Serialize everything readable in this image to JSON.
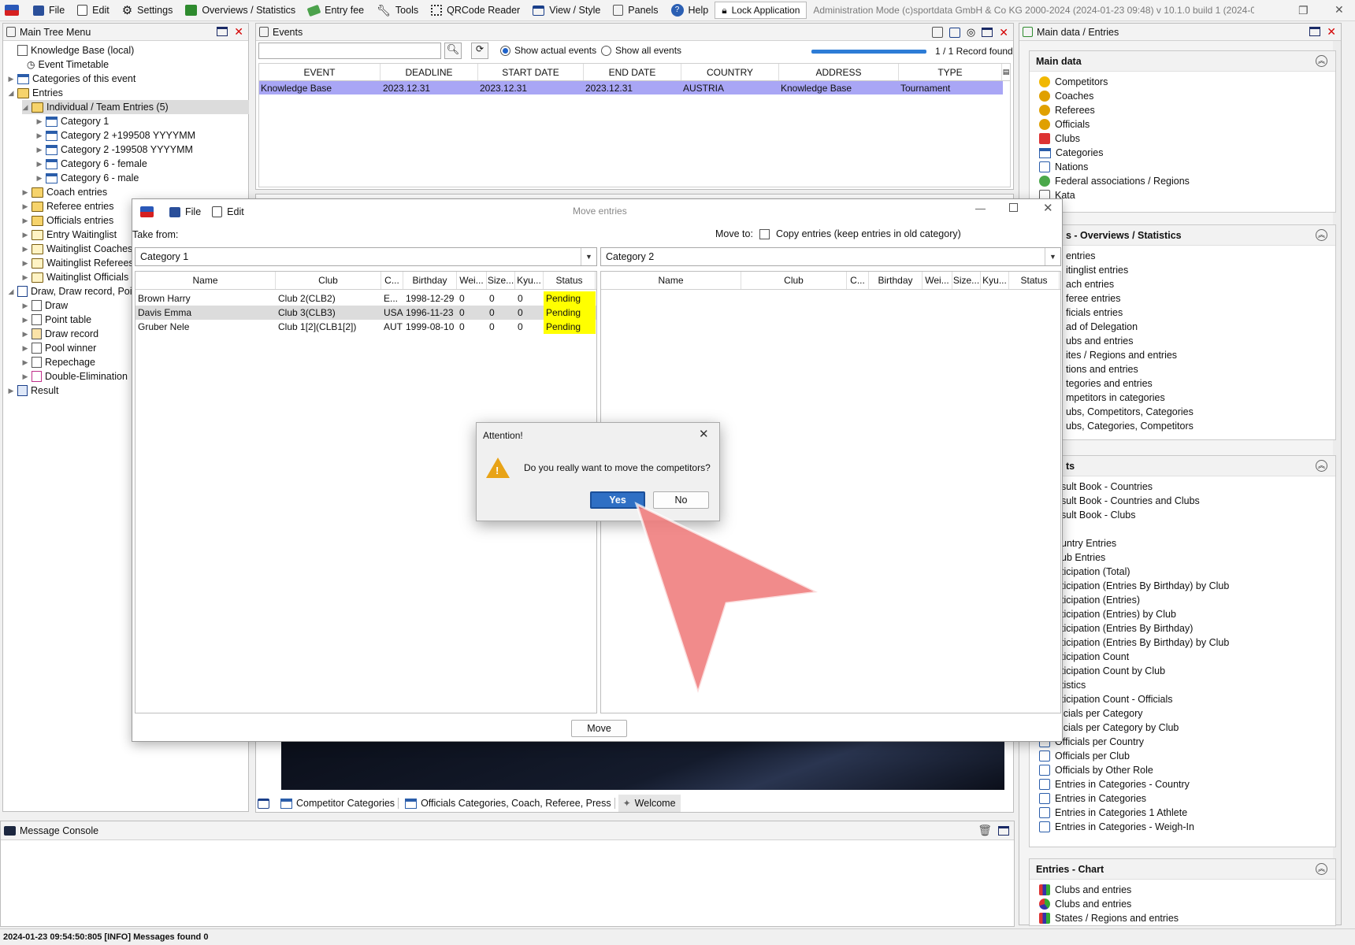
{
  "menu": {
    "items": [
      "File",
      "Edit",
      "Settings",
      "Overviews / Statistics",
      "Entry fee",
      "Tools",
      "QRCode Reader",
      "View / Style",
      "Panels",
      "Help"
    ],
    "lock_label": "Lock Application",
    "admin_text": "Administration Mode (c)sportdata GmbH & Co KG 2000-2024 (2024-01-23 09:48)  v 10.1.0 build 1 (2024-01..."
  },
  "tree_panel": {
    "title": "Main Tree Menu",
    "nodes": [
      {
        "label": "Knowledge Base (local)"
      },
      {
        "label": "Event Timetable"
      },
      {
        "label": "Categories of this event"
      },
      {
        "label": "Entries"
      },
      {
        "label": "Individual / Team Entries (5)"
      },
      {
        "label": "Category 1"
      },
      {
        "label": "Category 2 +199508 YYYYMM"
      },
      {
        "label": "Category 2 -199508 YYYYMM"
      },
      {
        "label": "Category 6 - female"
      },
      {
        "label": "Category 6 - male"
      },
      {
        "label": "Coach entries"
      },
      {
        "label": "Referee entries"
      },
      {
        "label": "Officials entries"
      },
      {
        "label": "Entry Waitinglist"
      },
      {
        "label": "Waitinglist Coaches"
      },
      {
        "label": "Waitinglist Referees"
      },
      {
        "label": "Waitinglist Officials"
      },
      {
        "label": "Draw, Draw record, Poi"
      },
      {
        "label": "Draw"
      },
      {
        "label": "Point table"
      },
      {
        "label": "Draw record"
      },
      {
        "label": "Pool winner"
      },
      {
        "label": "Repechage"
      },
      {
        "label": "Double-Elimination"
      },
      {
        "label": "Result"
      }
    ]
  },
  "events_panel": {
    "title": "Events",
    "radio_actual": "Show actual events",
    "radio_all": "Show all events",
    "record_found": "1 / 1 Record found",
    "columns": [
      "EVENT",
      "DEADLINE",
      "START DATE",
      "END DATE",
      "COUNTRY",
      "ADDRESS",
      "TYPE"
    ],
    "rows": [
      [
        "Knowledge Base",
        "2023.12.31",
        "2023.12.31",
        "2023.12.31",
        "AUSTRIA",
        "Knowledge Base",
        "Tournament"
      ]
    ]
  },
  "move_dialog": {
    "title": "Move entries",
    "menu_file": "File",
    "menu_edit": "Edit",
    "take_from_label": "Take from:",
    "move_to_label": "Move to:",
    "copy_label": "Copy entries (keep entries in old category)",
    "from_category": "Category 1",
    "to_category": "Category 2",
    "columns": [
      "Name",
      "Club",
      "C...",
      "Birthday",
      "Wei...",
      "Size...",
      "Kyu...",
      "Status"
    ],
    "rows": [
      [
        "Brown Harry",
        "Club 2(CLB2)",
        "E...",
        "1998-12-29",
        "0",
        "0",
        "0",
        "Pending"
      ],
      [
        "Davis Emma",
        "Club 3(CLB3)",
        "USA",
        "1996-11-23",
        "0",
        "0",
        "0",
        "Pending"
      ],
      [
        "Gruber Nele",
        "Club 1[2](CLB1[2])",
        "AUT",
        "1999-08-10",
        "0",
        "0",
        "0",
        "Pending"
      ]
    ],
    "move_button": "Move"
  },
  "attention": {
    "title": "Attention!",
    "message": "Do you really want to move the competitors?",
    "yes": "Yes",
    "no": "No"
  },
  "bottom_tabs": [
    "Competitor Categories",
    "Officials Categories, Coach, Referee, Press",
    "Welcome"
  ],
  "right_panel": {
    "title": "Main data / Entries",
    "main_data": {
      "header": "Main data",
      "items": [
        "Competitors",
        "Coaches",
        "Referees",
        "Officials",
        "Clubs",
        "Categories",
        "Nations",
        "Federal associations / Regions",
        "Kata"
      ]
    },
    "overviews": {
      "header": "s - Overviews / Statistics",
      "items": [
        "entries",
        "itinglist entries",
        "ach entries",
        "feree entries",
        "ficials entries",
        "ad of Delegation",
        "ubs and entries",
        "ites / Regions and entries",
        "tions and entries",
        "tegories and entries",
        "mpetitors in categories",
        "ubs, Competitors, Categories",
        "ubs, Categories, Competitors"
      ]
    },
    "results": {
      "header": "ts",
      "items": [
        "sult Book - Countries",
        "sult Book - Countries and Clubs",
        "sult Book - Clubs",
        "",
        "untry Entries",
        "ub Entries",
        "ticipation (Total)",
        "ticipation (Entries By Birthday) by Club",
        "ticipation (Entries)",
        "ticipation (Entries) by Club",
        "ticipation (Entries By Birthday)",
        "ticipation (Entries By Birthday) by Club",
        "ticipation Count",
        "ticipation Count by Club",
        "tistics",
        "ticipation Count - Officials",
        "icials per Category",
        "icials per Category by Club",
        "Officials per Country",
        "Officials per Club",
        "Officials by Other Role",
        "Entries in Categories - Country",
        "Entries in Categories",
        "Entries in Categories 1 Athlete",
        "Entries in Categories - Weigh-In"
      ]
    },
    "chart": {
      "header": "Entries - Chart",
      "items": [
        "Clubs and entries",
        "Clubs and entries",
        "States / Regions and entries"
      ]
    }
  },
  "console": {
    "title": "Message Console"
  },
  "status_bar": "2024-01-23 09:54:50:805 [INFO] Messages found 0"
}
